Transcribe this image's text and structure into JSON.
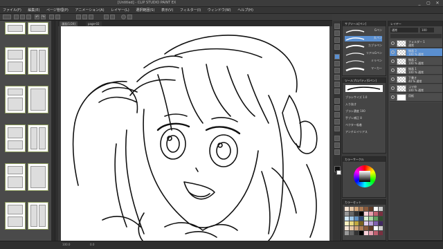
{
  "window": {
    "title": "[Untitled] - CLIP STUDIO PAINT EX",
    "controls": [
      "_",
      "▢",
      "✕"
    ]
  },
  "menu": [
    "ファイル(F)",
    "編集(E)",
    "ページ管理(P)",
    "アニメーション(A)",
    "レイヤー(L)",
    "選択範囲(S)",
    "表示(V)",
    "フィルター(I)",
    "ウィンドウ(W)",
    "ヘルプ(H)"
  ],
  "doc_tabs": [
    "漫画(1/24)",
    "page-02"
  ],
  "brush_panel": {
    "header": "サブツール[ペン]",
    "brushes": [
      "Gペン",
      "丸ペン",
      "カブラペン",
      "リアルGペン",
      "ミリペン",
      "マーカー"
    ]
  },
  "tool_props": {
    "header": "ツールプロパティ[Gペン]",
    "rows": [
      "ブラシサイズ  1.0",
      "入り抜き",
      "ブラシ濃度  100",
      "手ブレ補正  8",
      "ベクター吸着",
      "アンチエイリアス"
    ]
  },
  "color_panel": {
    "header": "カラーサークル"
  },
  "palette_panel": {
    "header": "カラーセット"
  },
  "layer_panel": {
    "header": "レイヤー",
    "blend": "通常",
    "opacity": "100",
    "layers": [
      {
        "name": "フォルダー 1",
        "sub": "通常"
      },
      {
        "name": "線画 3",
        "sub": "100 % 通常"
      },
      {
        "name": "線画 2",
        "sub": "100 % 通常"
      },
      {
        "name": "線画 1",
        "sub": "100 % 通常"
      },
      {
        "name": "下書き",
        "sub": "40 % 通常"
      },
      {
        "name": "コマ枠",
        "sub": "100 % 通常"
      },
      {
        "name": "用紙",
        "sub": ""
      }
    ]
  },
  "status": {
    "zoom": "100.0",
    "info": "0.0"
  },
  "colors": {
    "accent": "#5a8fd0"
  }
}
